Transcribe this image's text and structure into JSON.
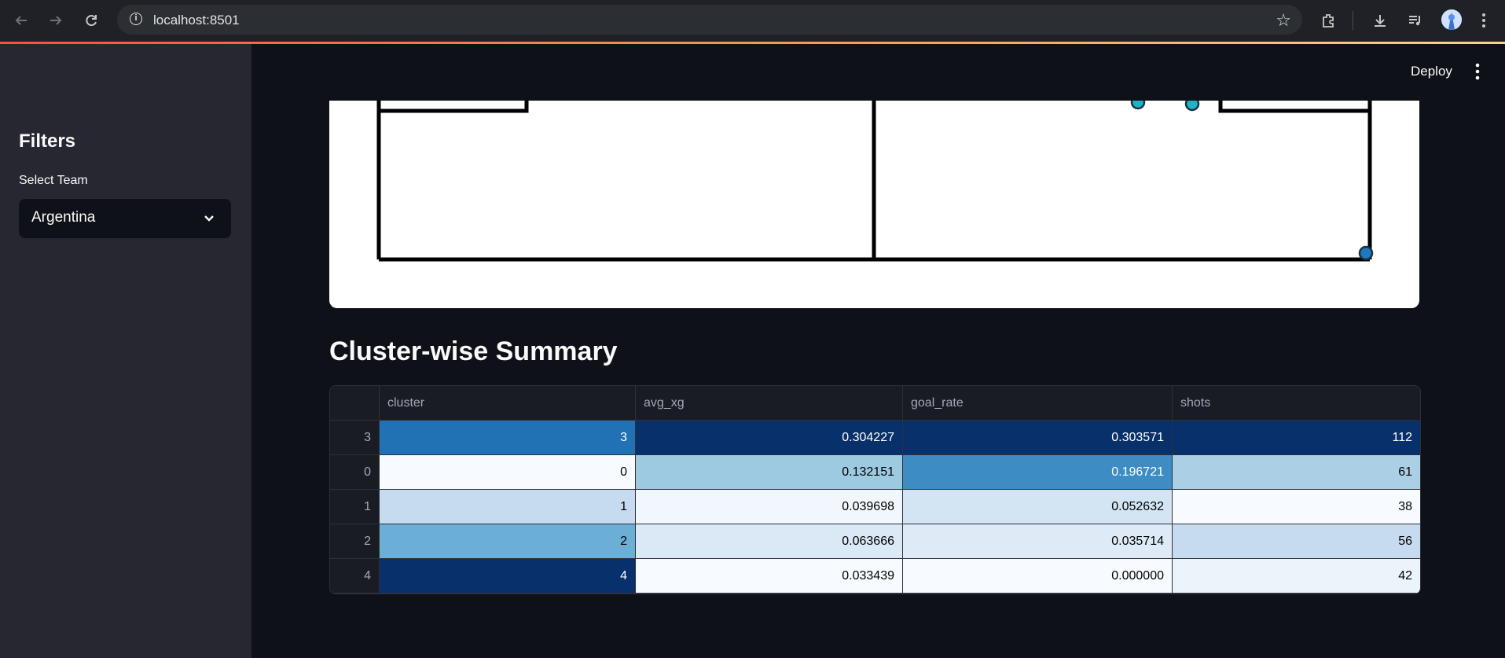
{
  "browser": {
    "url": "localhost:8501"
  },
  "app": {
    "deploy_label": "Deploy"
  },
  "sidebar": {
    "title": "Filters",
    "team_label": "Select Team",
    "team_value": "Argentina"
  },
  "summary": {
    "title": "Cluster-wise Summary",
    "columns": [
      "cluster",
      "avg_xg",
      "goal_rate",
      "shots"
    ],
    "rows": [
      {
        "index": "3",
        "cluster": "3",
        "avg_xg": "0.304227",
        "goal_rate": "0.303571",
        "shots": "112",
        "colors": {
          "cluster": "#2171b5",
          "avg_xg": "#08306b",
          "goal_rate": "#08306b",
          "shots": "#08306b"
        }
      },
      {
        "index": "0",
        "cluster": "0",
        "avg_xg": "0.132151",
        "goal_rate": "0.196721",
        "shots": "61",
        "colors": {
          "cluster": "#f7fbff",
          "avg_xg": "#9ecae1",
          "goal_rate": "#3d8dc4",
          "shots": "#abd0e6"
        }
      },
      {
        "index": "1",
        "cluster": "1",
        "avg_xg": "0.039698",
        "goal_rate": "0.052632",
        "shots": "38",
        "colors": {
          "cluster": "#c6dbef",
          "avg_xg": "#f1f7fd",
          "goal_rate": "#d3e4f3",
          "shots": "#f7fbff"
        }
      },
      {
        "index": "2",
        "cluster": "2",
        "avg_xg": "0.063666",
        "goal_rate": "0.035714",
        "shots": "56",
        "colors": {
          "cluster": "#6baed6",
          "avg_xg": "#dbe9f6",
          "goal_rate": "#deebf7",
          "shots": "#c6dbef"
        }
      },
      {
        "index": "4",
        "cluster": "4",
        "avg_xg": "0.033439",
        "goal_rate": "0.000000",
        "shots": "42",
        "colors": {
          "cluster": "#08306b",
          "avg_xg": "#f7fbff",
          "goal_rate": "#f7fbff",
          "shots": "#ebf3fb"
        }
      }
    ]
  }
}
